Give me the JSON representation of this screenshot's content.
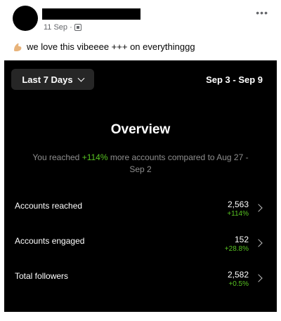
{
  "post": {
    "timestamp": "11 Sep",
    "separator": "·",
    "caption": "we love this vibeeee +++ on everythinggg",
    "more_label": "•••"
  },
  "insights": {
    "range_label": "Last 7 Days",
    "date_range": "Sep 3 - Sep 9",
    "title": "Overview",
    "reach_prefix": "You reached ",
    "reach_percent": "+114%",
    "reach_suffix": " more accounts compared to Aug 27 - Sep 2",
    "rows": [
      {
        "label": "Accounts reached",
        "value": "2,563",
        "change": "+114%"
      },
      {
        "label": "Accounts engaged",
        "value": "152",
        "change": "+28.8%"
      },
      {
        "label": "Total followers",
        "value": "2,582",
        "change": "+0.5%"
      }
    ]
  },
  "colors": {
    "accent_green": "#58c322",
    "panel_bg": "#000000",
    "button_bg": "#262626"
  },
  "icons": {
    "more": "more-horizontal-icon",
    "audience": "globe-icon",
    "emoji": "flexed-bicep-emoji-icon",
    "row_chevron": "chevron-right-icon",
    "range_chevron": "chevron-down-icon"
  }
}
